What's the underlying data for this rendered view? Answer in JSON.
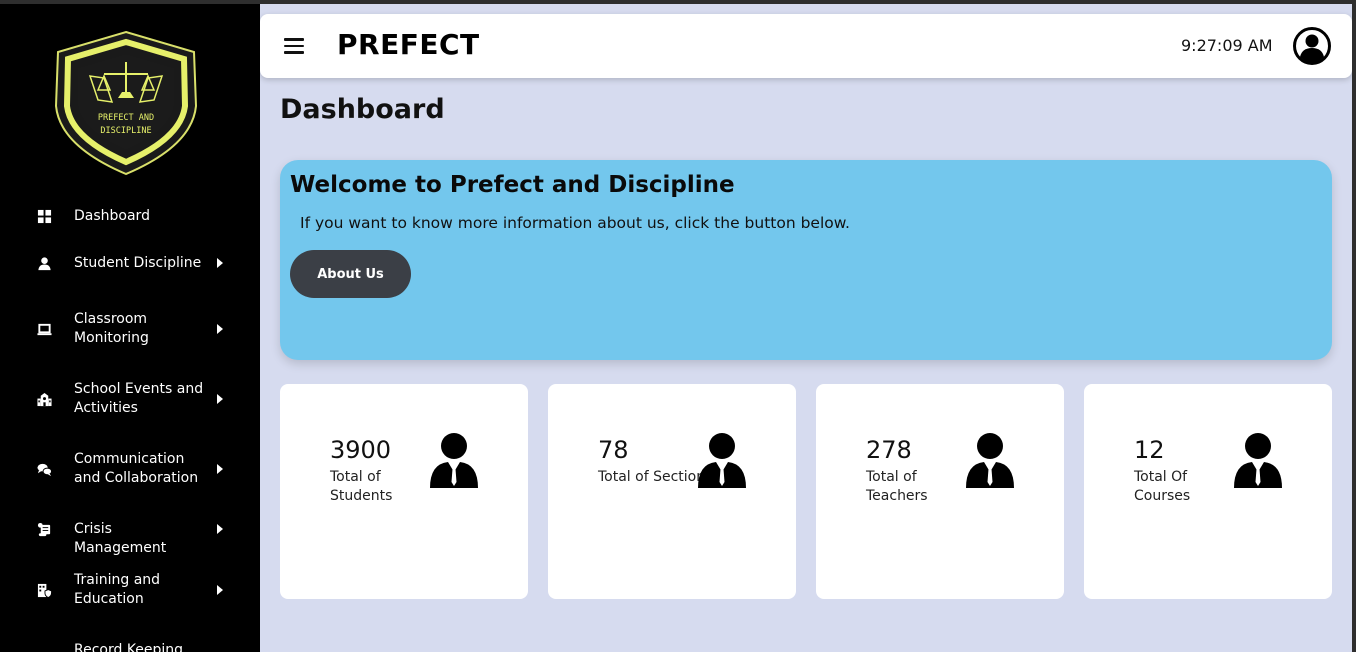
{
  "app": {
    "brand": "PREFECT",
    "logo_text_line1": "PREFECT AND",
    "logo_text_line2": "DISCIPLINE",
    "clock": "9:27:09 AM"
  },
  "sidebar": {
    "items": [
      {
        "label": "Dashboard",
        "icon": "grid-icon",
        "has_submenu": false
      },
      {
        "label": "Student Discipline",
        "icon": "person-icon",
        "has_submenu": true
      },
      {
        "label": "Classroom Monitoring",
        "icon": "laptop-icon",
        "has_submenu": true
      },
      {
        "label": "School Events and Activities",
        "icon": "school-icon",
        "has_submenu": true
      },
      {
        "label": "Communication and Collaboration",
        "icon": "chat-icon",
        "has_submenu": true
      },
      {
        "label": "Crisis Management",
        "icon": "scroll-icon",
        "has_submenu": true
      },
      {
        "label": "Training and Education",
        "icon": "building-shield-icon",
        "has_submenu": true
      },
      {
        "label": "Record Keeping and",
        "icon": "record-icon",
        "has_submenu": true
      }
    ]
  },
  "main": {
    "page_title": "Dashboard",
    "welcome": {
      "title": "Welcome to Prefect and Discipline",
      "text": "If you want to know more information about us, click the button below.",
      "button_label": "About Us"
    },
    "cards": [
      {
        "number": "3900",
        "label": "Total of Students",
        "icon": "user-tie-icon"
      },
      {
        "number": "78",
        "label": "Total of Section",
        "icon": "user-tie-icon"
      },
      {
        "number": "278",
        "label": "Total of Teachers",
        "icon": "user-tie-icon"
      },
      {
        "number": "12",
        "label": "Total Of Courses",
        "icon": "user-tie-icon"
      }
    ]
  },
  "colors": {
    "sidebar_bg": "#000000",
    "main_bg": "#d6dbef",
    "welcome_bg": "#73c7ed",
    "button_bg": "#3b3f46",
    "logo_accent": "#e6f06a"
  }
}
